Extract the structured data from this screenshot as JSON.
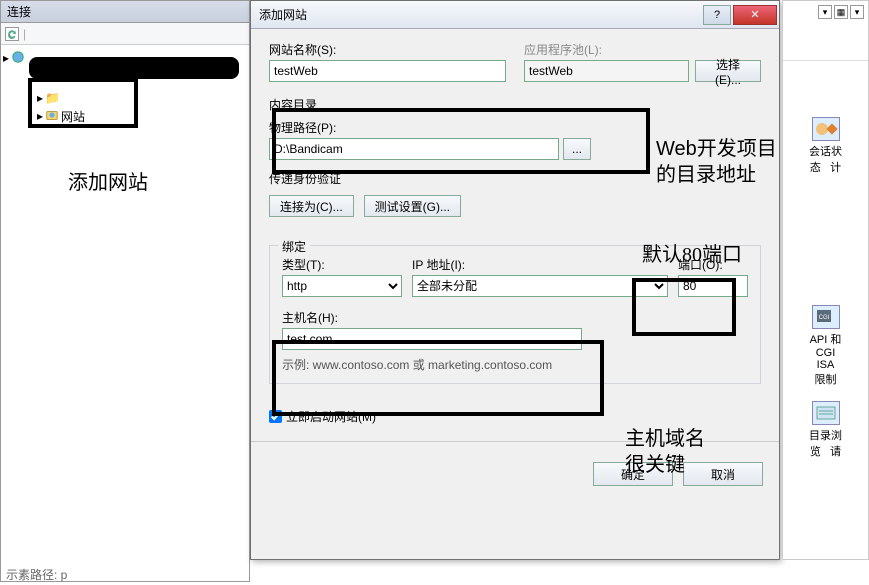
{
  "conn": {
    "title": "连接",
    "tree": {
      "sites_label": "网站"
    }
  },
  "dialog": {
    "title": "添加网站",
    "site_name_label": "网站名称(S):",
    "site_name_value": "testWeb",
    "apppool_label": "应用程序池(L):",
    "apppool_value": "testWeb",
    "select_btn": "选择(E)...",
    "content_dir_label": "内容目录",
    "phys_path_label": "物理路径(P):",
    "phys_path_value": "D:\\Bandicam",
    "browse_btn": "...",
    "passthrough_label": "传递身份验证",
    "connect_as_btn": "连接为(C)...",
    "test_settings_btn": "测试设置(G)...",
    "binding_label": "绑定",
    "type_label": "类型(T):",
    "type_value": "http",
    "ip_label": "IP 地址(I):",
    "ip_value": "全部未分配",
    "port_label": "端口(O):",
    "port_value": "80",
    "host_label": "主机名(H):",
    "host_value": "test.com",
    "example_text": "示例: www.contoso.com 或 marketing.contoso.com",
    "autostart_label": "立即启动网站(M)",
    "ok_btn": "确定",
    "cancel_btn": "取消"
  },
  "right": {
    "item1": "会话状态",
    "item1b": "计",
    "item2a": "API 和 CGI ISA",
    "item2b": "限制",
    "item3": "目录浏览",
    "item3b": "请"
  },
  "annot": {
    "add_site": "添加网站",
    "web_dir1": "Web开发项目",
    "web_dir2": "的目录地址",
    "port": "默认80端口",
    "host1": "主机域名",
    "host2": "很关键"
  },
  "bottom": "示素路径: p"
}
